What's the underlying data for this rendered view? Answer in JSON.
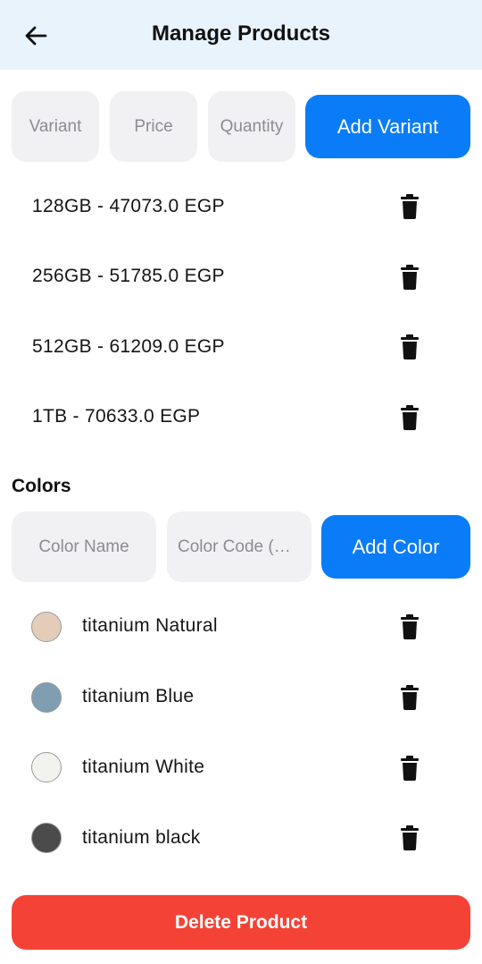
{
  "header": {
    "title": "Manage Products",
    "back_icon": "arrow-left-icon"
  },
  "variant_form": {
    "variant_placeholder": "Variant",
    "price_placeholder": "Price",
    "quantity_placeholder": "Quantity",
    "add_label": "Add Variant"
  },
  "variants": [
    {
      "label": "128GB - 47073.0 EGP"
    },
    {
      "label": "256GB - 51785.0 EGP"
    },
    {
      "label": "512GB - 61209.0 EGP"
    },
    {
      "label": "1TB - 70633.0 EGP"
    }
  ],
  "colors_section": {
    "title": "Colors"
  },
  "color_form": {
    "name_placeholder": "Color Name",
    "code_placeholder": "Color Code (Hex)",
    "add_label": "Add Color"
  },
  "colors": [
    {
      "name": "titanium Natural",
      "hex": "#e3cdb8"
    },
    {
      "name": "titanium Blue",
      "hex": "#7f9eb2"
    },
    {
      "name": "titanium White",
      "hex": "#f2f2ee"
    },
    {
      "name": "titanium black",
      "hex": "#4b4b4b"
    }
  ],
  "footer": {
    "delete_label": "Delete Product"
  },
  "theme": {
    "accent": "#0a7cf7",
    "danger": "#f44336",
    "appbar": "#e9f3fc"
  }
}
